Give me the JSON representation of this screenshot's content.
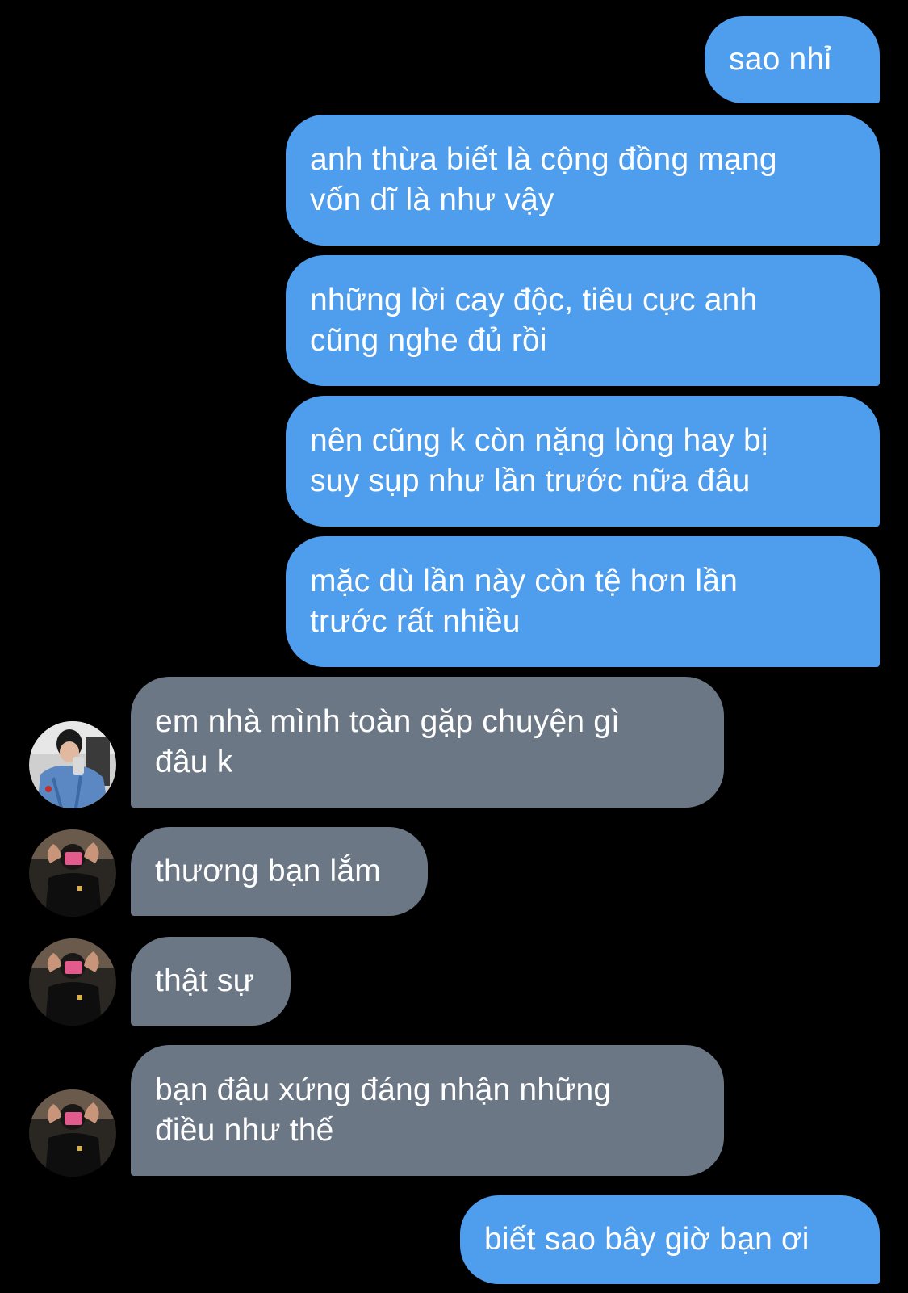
{
  "colors": {
    "background": "#000000",
    "outgoing_bubble": "#4f9ded",
    "incoming_bubble": "#6c7785",
    "text": "#ffffff"
  },
  "messages": [
    {
      "direction": "outgoing",
      "text": "sao nhỉ"
    },
    {
      "direction": "outgoing",
      "text": "anh thừa biết là cộng đồng mạng\nvốn dĩ là như vậy"
    },
    {
      "direction": "outgoing",
      "text": "những lời cay độc, tiêu cực anh\ncũng nghe đủ rồi"
    },
    {
      "direction": "outgoing",
      "text": "nên cũng k còn nặng lòng hay bị\nsuy sụp như lần trước nữa đâu"
    },
    {
      "direction": "outgoing",
      "text": "mặc dù lần này còn tệ hơn lần\ntrước rất nhiều"
    },
    {
      "direction": "incoming",
      "text": "em nhà mình toàn gặp chuyện gì\nđâu k",
      "avatar": "avatar-denim-jacket-photo"
    },
    {
      "direction": "incoming",
      "text": "thương bạn lắm",
      "avatar": "avatar-mirror-selfie-photo"
    },
    {
      "direction": "incoming",
      "text": "thật sự",
      "avatar": "avatar-mirror-selfie-photo"
    },
    {
      "direction": "incoming",
      "text": "bạn đâu xứng đáng nhận những\nđiều như thế",
      "avatar": "avatar-mirror-selfie-photo"
    },
    {
      "direction": "outgoing",
      "text": "biết sao bây giờ bạn ơi"
    }
  ]
}
